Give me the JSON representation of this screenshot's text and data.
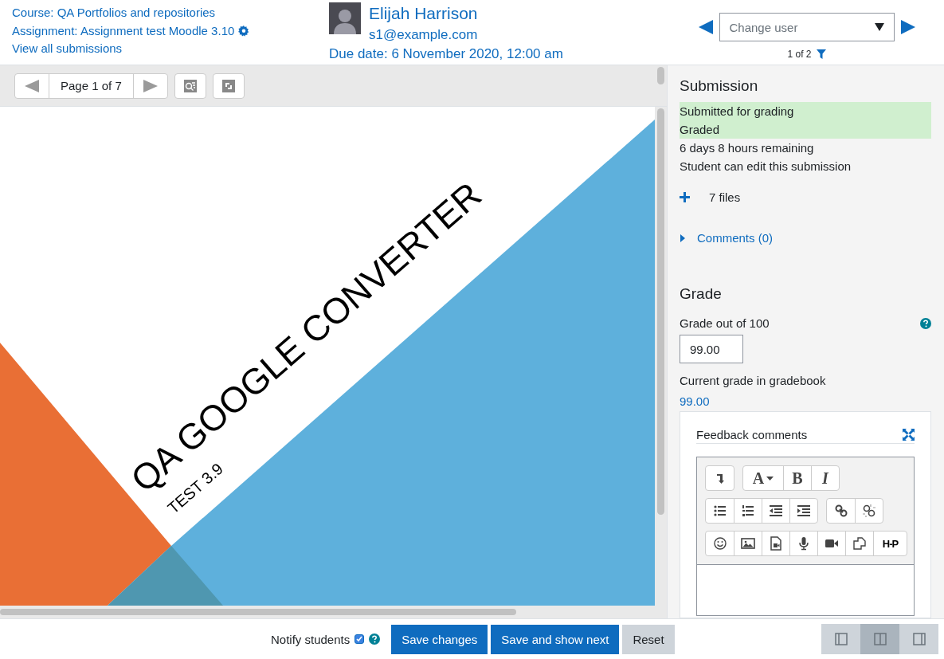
{
  "header": {
    "course_link": "Course: QA Portfolios and repositories",
    "assignment_link": "Assignment: Assignment test Moodle 3.10",
    "view_all_link": "View all submissions",
    "user_name": "Elijah Harrison",
    "user_email": "s1@example.com",
    "due_date": "Due date: 6 November 2020, 12:00 am",
    "change_user": {
      "placeholder": "Change user"
    },
    "user_count": "1 of 2"
  },
  "viewer": {
    "page_label": "Page 1 of 7",
    "slide": {
      "title": "QA GOOGLE CONVERTER",
      "subtitle": "TEST 3.9"
    }
  },
  "submission": {
    "heading": "Submission",
    "statuses": [
      {
        "text": "Submitted for grading",
        "highlighted": true
      },
      {
        "text": "Graded",
        "highlighted": true
      },
      {
        "text": "6 days 8 hours remaining",
        "highlighted": false
      },
      {
        "text": "Student can edit this submission",
        "highlighted": false
      }
    ],
    "files": {
      "label": "7 files",
      "expanded": false
    },
    "comments": {
      "label": "Comments (0)",
      "expanded": false
    }
  },
  "grade": {
    "heading": "Grade",
    "grade_label": "Grade out of 100",
    "grade_value": "99.00",
    "current_label": "Current grade in gradebook",
    "current_value": "99.00"
  },
  "feedback": {
    "label": "Feedback comments",
    "toolbar": {
      "font_button": "A",
      "bold_button": "B",
      "italic_button": "I",
      "h5p_button": "H-P"
    }
  },
  "footer": {
    "notify": {
      "label": "Notify students",
      "checked": true
    },
    "buttons": [
      {
        "label": "Save changes",
        "kind": "primary"
      },
      {
        "label": "Save and show next",
        "kind": "primary"
      },
      {
        "label": "Reset",
        "kind": "secondary"
      }
    ],
    "layout_modes": [
      {
        "selected": false
      },
      {
        "selected": true
      },
      {
        "selected": false
      }
    ]
  }
}
